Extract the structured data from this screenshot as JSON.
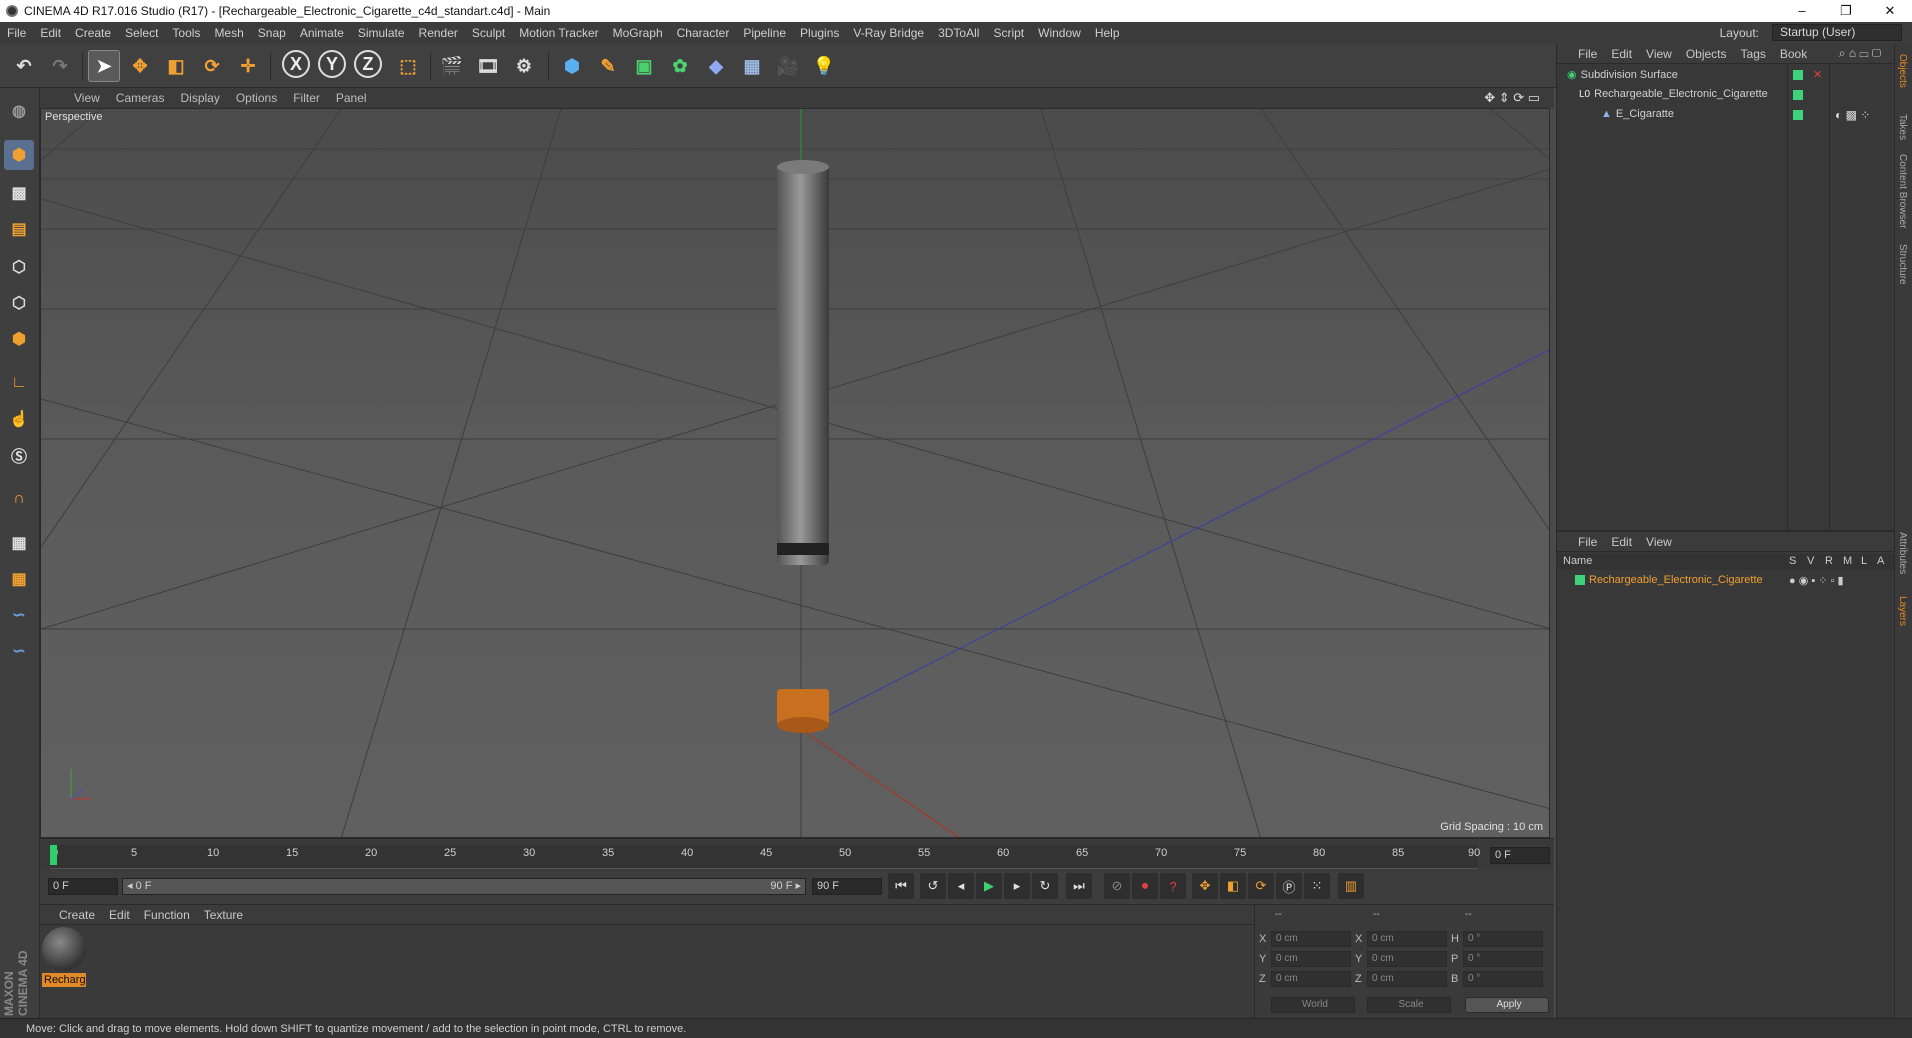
{
  "window": {
    "title": "CINEMA 4D R17.016 Studio (R17) - [Rechargeable_Electronic_Cigarette_c4d_standart.c4d] - Main",
    "controls": [
      "–",
      "❐",
      "✕"
    ]
  },
  "menubar": {
    "items": [
      "File",
      "Edit",
      "Create",
      "Select",
      "Tools",
      "Mesh",
      "Snap",
      "Animate",
      "Simulate",
      "Render",
      "Sculpt",
      "Motion Tracker",
      "MoGraph",
      "Character",
      "Pipeline",
      "Plugins",
      "V-Ray Bridge",
      "3DToAll",
      "Script",
      "Window",
      "Help"
    ],
    "layout_label": "Layout:",
    "layout_value": "Startup (User)"
  },
  "toolbar": {
    "axis_x": "X",
    "axis_y": "Y",
    "axis_z": "Z"
  },
  "viewport": {
    "menu": [
      "View",
      "Cameras",
      "Display",
      "Options",
      "Filter",
      "Panel"
    ],
    "label": "Perspective",
    "grid_spacing": "Grid Spacing : 10 cm"
  },
  "timeline": {
    "ticks": [
      "0",
      "5",
      "10",
      "15",
      "20",
      "25",
      "30",
      "35",
      "40",
      "45",
      "50",
      "55",
      "60",
      "65",
      "70",
      "75",
      "80",
      "85",
      "90"
    ],
    "current_frame": "0 F",
    "start_field": "0 F",
    "range_start": "◂ 0 F",
    "range_end": "90 F ▸",
    "end_field": "90 F"
  },
  "materials": {
    "menu": [
      "Create",
      "Edit",
      "Function",
      "Texture"
    ],
    "items": [
      {
        "label": "Recharg"
      }
    ]
  },
  "coordinates": {
    "headers": [
      "--",
      "--",
      "--"
    ],
    "rows": [
      {
        "a": "X",
        "av": "0 cm",
        "b": "X",
        "bv": "0 cm",
        "c": "H",
        "cv": "0 °"
      },
      {
        "a": "Y",
        "av": "0 cm",
        "b": "Y",
        "bv": "0 cm",
        "c": "P",
        "cv": "0 °"
      },
      {
        "a": "Z",
        "av": "0 cm",
        "b": "Z",
        "bv": "0 cm",
        "c": "B",
        "cv": "0 °"
      }
    ],
    "mode": "World",
    "scale": "Scale",
    "apply": "Apply"
  },
  "objects": {
    "menu": [
      "File",
      "Edit",
      "View",
      "Objects",
      "Tags",
      "Book"
    ],
    "tree": [
      {
        "name": "Subdivision Surface"
      },
      {
        "name": "Rechargeable_Electronic_Cigarette"
      },
      {
        "name": "E_Cigaratte"
      }
    ]
  },
  "layers": {
    "menu": [
      "File",
      "Edit",
      "View"
    ],
    "col_name": "Name",
    "cols": [
      "S",
      "V",
      "R",
      "M",
      "L",
      "A"
    ],
    "items": [
      {
        "name": "Rechargeable_Electronic_Cigarette"
      }
    ]
  },
  "side_tabs": [
    "Objects",
    "Takes",
    "Content Browser",
    "Structure",
    "Attributes",
    "Layers"
  ],
  "branding": "MAXON CINEMA 4D",
  "status": "Move: Click and drag to move elements. Hold down SHIFT to quantize movement / add to the selection in point mode, CTRL to remove."
}
